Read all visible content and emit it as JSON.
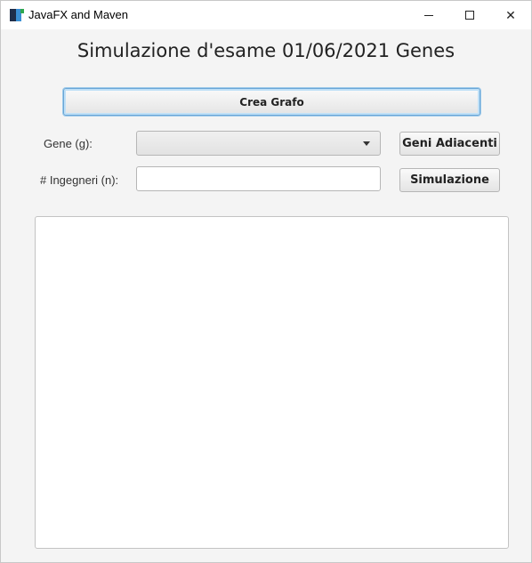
{
  "window": {
    "title": "JavaFX and Maven",
    "icon": "java-app-icon",
    "controls": {
      "minimize": "minimize-icon",
      "maximize": "maximize-icon",
      "close_label": "✕"
    }
  },
  "header": {
    "title": "Simulazione d'esame 01/06/2021 Genes"
  },
  "actions": {
    "crea_grafo_label": "Crea Grafo",
    "geni_adiacenti_label": "Geni Adiacenti",
    "simulazione_label": "Simulazione"
  },
  "form": {
    "gene_label": "Gene (g):",
    "gene_selected": "",
    "ingegneri_label": "# Ingegneri (n):",
    "ingegneri_value": "",
    "ingegneri_placeholder": ""
  },
  "output": {
    "text": ""
  },
  "colors": {
    "window_bg": "#f4f4f4",
    "focus_border": "#6aa6d6"
  }
}
